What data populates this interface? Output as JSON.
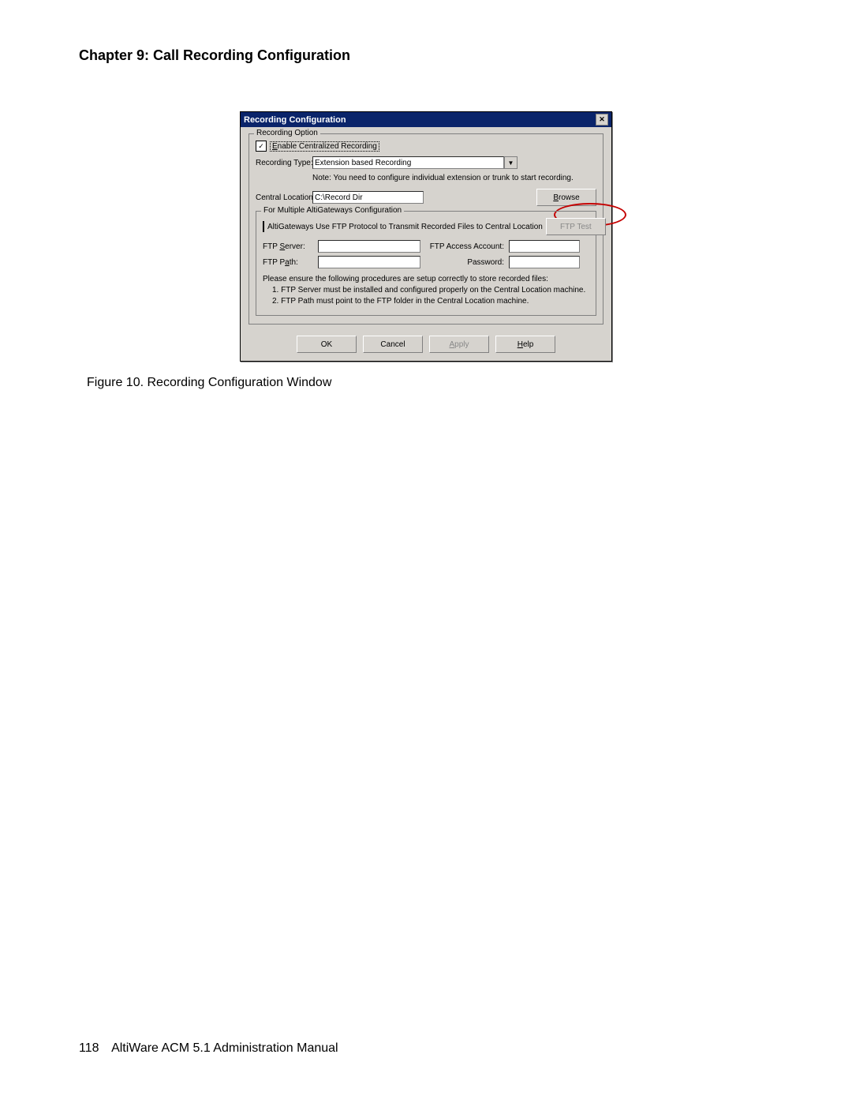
{
  "page": {
    "chapter_title": "Chapter 9:  Call Recording Configuration",
    "figure_caption": "Figure 10.   Recording Configuration Window",
    "footer_page_number": "118",
    "footer_text": "AltiWare ACM 5.1 Administration Manual"
  },
  "dialog": {
    "title": "Recording Configuration",
    "close_glyph": "✕",
    "group_recording_option": "Recording Option",
    "enable_checkbox_checked": "✓",
    "enable_pre": "E",
    "enable_label_rest": "nable Centralized Recording",
    "recording_type_label": "Recording Type:",
    "recording_type_value": "Extension based Recording",
    "dropdown_glyph": "▼",
    "note_text": "Note: You need to configure individual extension or trunk to start recording.",
    "central_location_label": "Central Location:",
    "central_location_value": "C:\\Record Dir",
    "browse_pre": "B",
    "browse_rest": "rowse",
    "inner_group": "For Multiple AltiGateways Configuration",
    "ftp_checkbox_label": "AltiGateways Use FTP Protocol to Transmit Recorded Files to Central Location",
    "ftp_test_label": "FTP Test",
    "ftp_server_pre": "FTP ",
    "ftp_server_ul": "S",
    "ftp_server_rest": "erver:",
    "ftp_access_label": "FTP Access Account:",
    "ftp_path_pre": "FTP P",
    "ftp_path_ul": "a",
    "ftp_path_rest": "th:",
    "password_label": "Password:",
    "proc_intro": "Please ensure the following procedures are setup correctly to store recorded files:",
    "proc_1": "1. FTP Server must be installed and configured properly on the Central Location machine.",
    "proc_2": "2. FTP Path must point to the FTP folder in the Central Location machine.",
    "btn_ok": "OK",
    "btn_cancel": "Cancel",
    "btn_apply_ul": "A",
    "btn_apply_rest": "pply",
    "btn_help_ul": "H",
    "btn_help_rest": "elp"
  }
}
